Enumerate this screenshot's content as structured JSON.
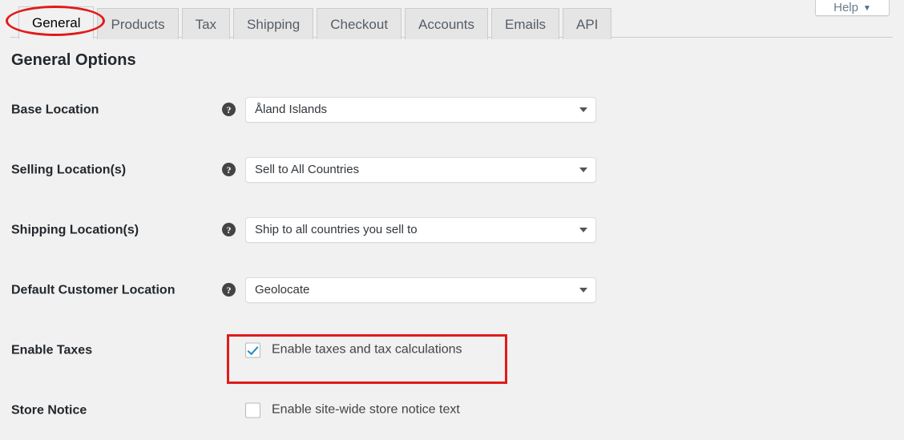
{
  "help_button": {
    "label": "Help",
    "caret": "▼",
    "icon": "chevron-down-icon"
  },
  "tabs": [
    {
      "label": "General",
      "active": true,
      "name": "tab-general"
    },
    {
      "label": "Products",
      "active": false,
      "name": "tab-products"
    },
    {
      "label": "Tax",
      "active": false,
      "name": "tab-tax"
    },
    {
      "label": "Shipping",
      "active": false,
      "name": "tab-shipping"
    },
    {
      "label": "Checkout",
      "active": false,
      "name": "tab-checkout"
    },
    {
      "label": "Accounts",
      "active": false,
      "name": "tab-accounts"
    },
    {
      "label": "Emails",
      "active": false,
      "name": "tab-emails"
    },
    {
      "label": "API",
      "active": false,
      "name": "tab-api"
    }
  ],
  "page": {
    "heading": "General Options"
  },
  "options": [
    {
      "label": "Base Location",
      "type": "select",
      "help_icon": "help-tip-icon",
      "value": "Åland Islands",
      "caret_icon": "chevron-down-icon"
    },
    {
      "label": "Selling Location(s)",
      "type": "select",
      "help_icon": "help-tip-icon",
      "value": "Sell to All Countries",
      "caret_icon": "chevron-down-icon"
    },
    {
      "label": "Shipping Location(s)",
      "type": "select",
      "help_icon": "help-tip-icon",
      "value": "Ship to all countries you sell to",
      "caret_icon": "chevron-down-icon"
    },
    {
      "label": "Default Customer Location",
      "type": "select",
      "help_icon": "help-tip-icon",
      "value": "Geolocate",
      "caret_icon": "chevron-down-icon"
    },
    {
      "label": "Enable Taxes",
      "type": "checkbox",
      "checkbox_label": "Enable taxes and tax calculations",
      "checked": true
    },
    {
      "label": "Store Notice",
      "type": "checkbox",
      "checkbox_label": "Enable site-wide store notice text",
      "checked": false
    }
  ],
  "annotations": [
    {
      "shape": "ellipse",
      "target": "tab-general",
      "color": "#e01b1b"
    },
    {
      "shape": "rectangle",
      "target": "enable-taxes",
      "color": "#e01b1b"
    }
  ],
  "colors": {
    "page_background": "#f1f1f1",
    "tab_inactive_background": "#e5e5e5",
    "tab_border": "#cccccc",
    "checkbox_check": "#1e8cbe",
    "annotation_red": "#e01b1b",
    "heading_text": "#23282d"
  }
}
